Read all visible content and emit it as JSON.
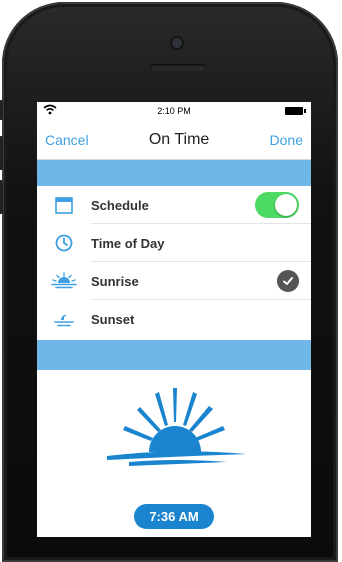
{
  "status_bar": {
    "time": "2:10 PM"
  },
  "nav": {
    "cancel": "Cancel",
    "title": "On Time",
    "done": "Done"
  },
  "options": [
    {
      "label": "Schedule",
      "icon": "calendar-icon",
      "control": "toggle",
      "on": true
    },
    {
      "label": "Time of Day",
      "icon": "clock-icon",
      "control": "none"
    },
    {
      "label": "Sunrise",
      "icon": "sunrise-icon",
      "control": "check",
      "selected": true
    },
    {
      "label": "Sunset",
      "icon": "sunset-icon",
      "control": "none"
    }
  ],
  "time_value": "7:36 AM",
  "colors": {
    "accent": "#3ea0e0",
    "band": "#6fb7e6",
    "toggle_on": "#4cd964",
    "pill": "#1a84cf"
  }
}
